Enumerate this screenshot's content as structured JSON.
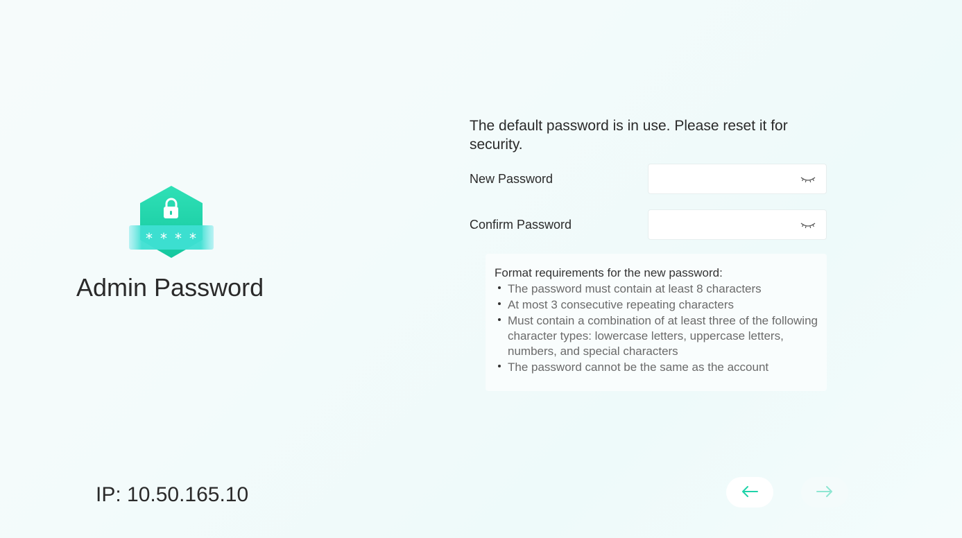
{
  "left": {
    "title": "Admin Password",
    "ip": "IP: 10.50.165.10"
  },
  "form": {
    "notice": "The default password is in use. Please reset it for security.",
    "new_password_label": "New Password",
    "new_password_value": "",
    "confirm_password_label": "Confirm Password",
    "confirm_password_value": ""
  },
  "requirements": {
    "title": "Format requirements for the new password:",
    "items": [
      "The password must contain at least 8 characters",
      "At most 3 consecutive repeating characters",
      "Must contain a combination of at least three of the following character types: lowercase letters, uppercase letters, numbers, and special characters",
      "The password cannot be the same as the account"
    ]
  },
  "navigation": {
    "back_icon": "arrow-left-icon",
    "next_icon": "arrow-right-icon"
  },
  "colors": {
    "accent": "#1fd3a9",
    "accent_light": "#8ee6d2",
    "background": "#f3fbfb"
  },
  "icons": {
    "shield": "shield-lock-icon",
    "eye": "eye-closed-icon"
  }
}
